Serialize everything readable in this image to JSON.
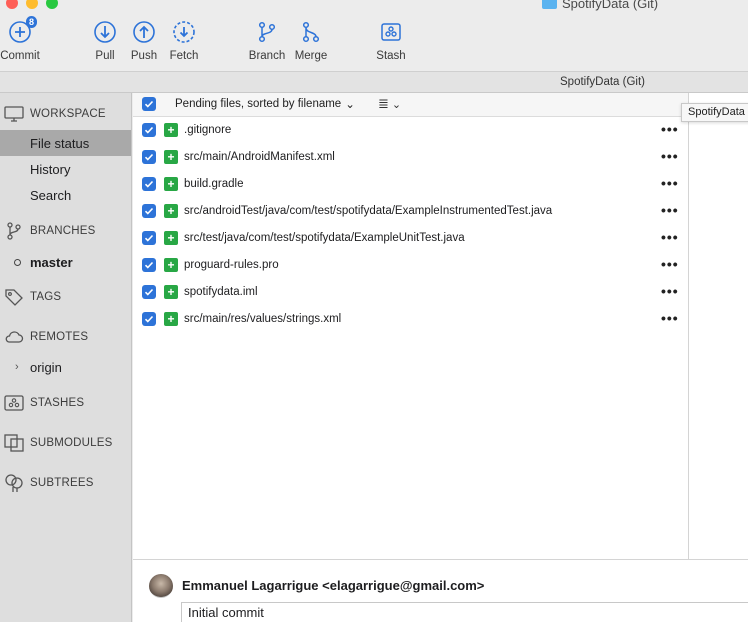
{
  "window": {
    "title": "SpotifyData (Git)"
  },
  "toolbar": {
    "commit_label": "Commit",
    "commit_badge": "8",
    "pull_label": "Pull",
    "push_label": "Push",
    "fetch_label": "Fetch",
    "branch_label": "Branch",
    "merge_label": "Merge",
    "stash_label": "Stash"
  },
  "pathbar": {
    "title": "SpotifyData (Git)"
  },
  "sidebar": {
    "workspace_label": "WORKSPACE",
    "file_status_label": "File status",
    "history_label": "History",
    "search_label": "Search",
    "branches_label": "BRANCHES",
    "master_label": "master",
    "tags_label": "TAGS",
    "remotes_label": "REMOTES",
    "origin_label": "origin",
    "stashes_label": "STASHES",
    "submodules_label": "SUBMODULES",
    "subtrees_label": "SUBTREES"
  },
  "filelist": {
    "sort_label": "Pending files, sorted by filename",
    "files": [
      ".gitignore",
      "src/main/AndroidManifest.xml",
      "build.gradle",
      "src/androidTest/java/com/test/spotifydata/ExampleInstrumentedTest.java",
      "src/test/java/com/test/spotifydata/ExampleUnitTest.java",
      "proguard-rules.pro",
      "spotifydata.iml",
      "src/main/res/values/strings.xml"
    ],
    "more_glyph": "•••"
  },
  "tooltip": {
    "text": "SpotifyData"
  },
  "commit": {
    "author": "Emmanuel Lagarrigue <elagarrigue@gmail.com>",
    "message": "Initial commit"
  },
  "colors": {
    "accent": "#2d73d8",
    "added": "#28a745",
    "selected_row": "#a9a9a9"
  }
}
